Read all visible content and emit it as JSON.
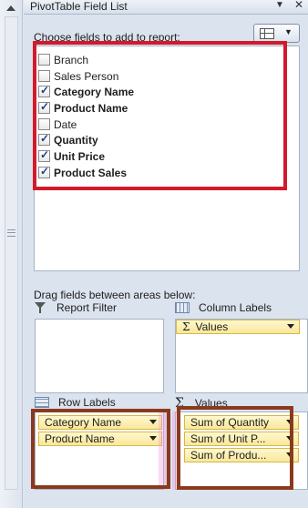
{
  "panel": {
    "title": "PivotTable Field List",
    "title_dropdown_icon": "dropdown-arrow-icon",
    "close_icon": "close-icon"
  },
  "choose_label": "Choose fields to add to report:",
  "layout_button": {
    "icon": "field-layout-icon",
    "dropdown_icon": "dropdown-arrow-icon"
  },
  "fields": [
    {
      "label": "Branch",
      "checked": false
    },
    {
      "label": "Sales Person",
      "checked": false
    },
    {
      "label": "Category Name",
      "checked": true
    },
    {
      "label": "Product Name",
      "checked": true
    },
    {
      "label": "Date",
      "checked": false
    },
    {
      "label": "Quantity",
      "checked": true
    },
    {
      "label": "Unit Price",
      "checked": true
    },
    {
      "label": "Product Sales",
      "checked": true
    }
  ],
  "drag_label": "Drag fields between areas below:",
  "areas": {
    "report_filter": {
      "label": "Report Filter"
    },
    "column_labels": {
      "label": "Column Labels",
      "items": [
        "Values"
      ]
    },
    "row_labels": {
      "label": "Row Labels",
      "items": [
        "Category Name",
        "Product Name"
      ]
    },
    "values": {
      "label": "Values",
      "items": [
        "Sum of Quantity",
        "Sum of Unit P...",
        "Sum of Produ..."
      ]
    }
  },
  "colors": {
    "highlight_red": "#d3192b",
    "highlight_brown": "#8a3a1c",
    "chip_fill": "#f9e79a"
  }
}
